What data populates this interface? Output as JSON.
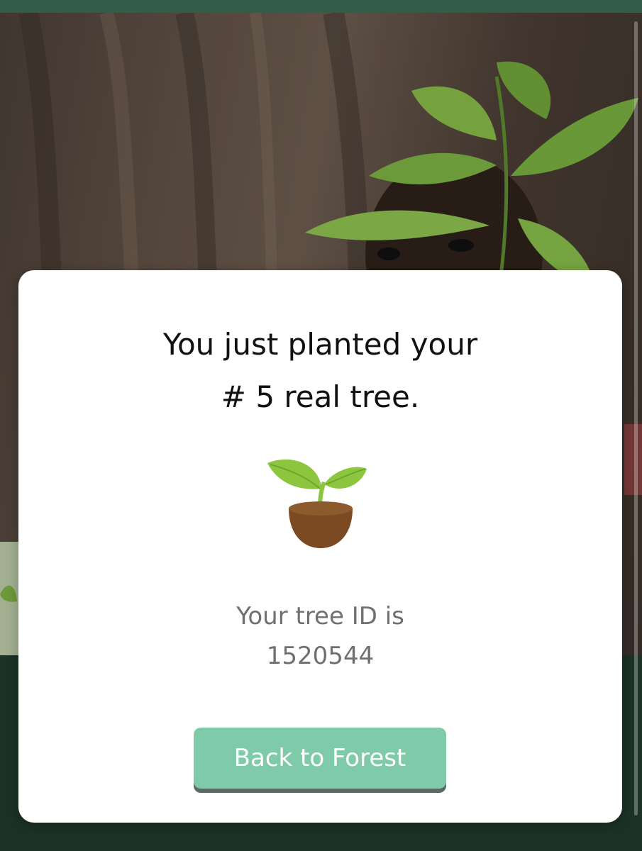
{
  "modal": {
    "title_line1": "You just planted your",
    "title_line2": "# 5 real tree.",
    "tree_id_label": "Your tree ID is",
    "tree_id_value": "1520544",
    "back_button_label": "Back to Forest",
    "illustration_icon": "sapling-icon"
  },
  "colors": {
    "button": "#7fcaa9",
    "panel_background": "#1f3a2c",
    "top_bar": "#3a6a55",
    "leaf_green": "#8cc63f",
    "soil_brown": "#7b4a22"
  }
}
